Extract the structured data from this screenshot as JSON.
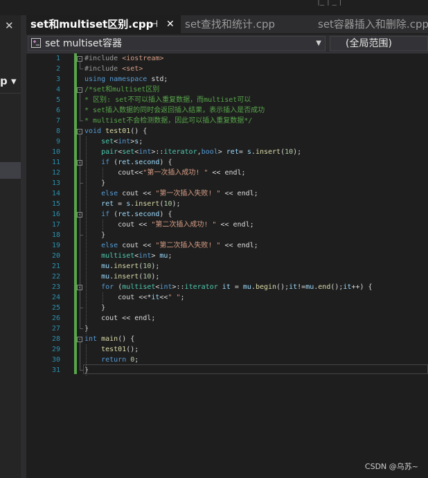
{
  "window": {
    "top_glyphs": "|_ | _ |"
  },
  "left_panel": {
    "close_glyph": "✕",
    "menu_label": "p ▾"
  },
  "tabs": [
    {
      "label": "set和multiset区别.cpp",
      "active": true,
      "pin_glyph": "⊣",
      "close_glyph": "✕"
    },
    {
      "label": "set查找和统计.cpp",
      "active": false
    },
    {
      "label": "set容器插入和删除.cpp",
      "active": false
    }
  ],
  "nav": {
    "scope_label": "set multiset容器",
    "member_label": "(全局范围)"
  },
  "editor": {
    "lines": [
      {
        "n": "1",
        "segs": [
          [
            "pp",
            "#include "
          ],
          [
            "st",
            "<iostream>"
          ]
        ]
      },
      {
        "n": "2",
        "segs": [
          [
            "pp",
            "#include "
          ],
          [
            "st",
            "<set>"
          ]
        ]
      },
      {
        "n": "3",
        "segs": [
          [
            "kw",
            "using namespace "
          ],
          [
            "",
            "std;"
          ]
        ]
      },
      {
        "n": "4",
        "segs": [
          [
            "cm",
            "/*set和multiset区别"
          ]
        ]
      },
      {
        "n": "5",
        "segs": [
          [
            "cm",
            "* 区别: set不可以插入重复数据，而multiset可以"
          ]
        ]
      },
      {
        "n": "6",
        "segs": [
          [
            "cm",
            "* set插入数据的同时会返回插入结果，表示插入是否成功"
          ]
        ]
      },
      {
        "n": "7",
        "segs": [
          [
            "cm",
            "* multiset不会检测数据，因此可以插入重复数据*/"
          ]
        ]
      },
      {
        "n": "8",
        "segs": [
          [
            "kw",
            "void "
          ],
          [
            "fn",
            "test01"
          ],
          [
            "",
            "() {"
          ]
        ]
      },
      {
        "n": "9",
        "segs": [
          [
            "",
            "    "
          ],
          [
            "ty",
            "set"
          ],
          [
            "",
            "<"
          ],
          [
            "kw",
            "int"
          ],
          [
            "",
            ">"
          ],
          [
            "va",
            "s"
          ],
          [
            "",
            ";"
          ]
        ]
      },
      {
        "n": "10",
        "segs": [
          [
            "",
            "    "
          ],
          [
            "ty",
            "pair"
          ],
          [
            "",
            "<"
          ],
          [
            "ty",
            "set"
          ],
          [
            "",
            "<"
          ],
          [
            "kw",
            "int"
          ],
          [
            "",
            ">::"
          ],
          [
            "ty",
            "iterator"
          ],
          [
            "",
            ","
          ],
          [
            "kw",
            "bool"
          ],
          [
            "",
            "> "
          ],
          [
            "va",
            "ret"
          ],
          [
            "",
            "= "
          ],
          [
            "va",
            "s"
          ],
          [
            "",
            "."
          ],
          [
            "fn",
            "insert"
          ],
          [
            "",
            "("
          ],
          [
            "nm",
            "10"
          ],
          [
            "",
            ");"
          ]
        ]
      },
      {
        "n": "11",
        "segs": [
          [
            "",
            "    "
          ],
          [
            "kw",
            "if "
          ],
          [
            "",
            "("
          ],
          [
            "va",
            "ret"
          ],
          [
            "",
            "."
          ],
          [
            "va",
            "second"
          ],
          [
            "",
            ") {"
          ]
        ]
      },
      {
        "n": "12",
        "segs": [
          [
            "",
            "        cout<<"
          ],
          [
            "st",
            "\"第一次插入成功! \""
          ],
          [
            "",
            " << endl;"
          ]
        ]
      },
      {
        "n": "13",
        "segs": [
          [
            "",
            "    }"
          ]
        ]
      },
      {
        "n": "14",
        "segs": [
          [
            "",
            "    "
          ],
          [
            "kw",
            "else "
          ],
          [
            "",
            "cout << "
          ],
          [
            "st",
            "\"第一次插入失败! \""
          ],
          [
            "",
            " << endl;"
          ]
        ]
      },
      {
        "n": "15",
        "segs": [
          [
            "",
            "    "
          ],
          [
            "va",
            "ret"
          ],
          [
            "",
            " = "
          ],
          [
            "va",
            "s"
          ],
          [
            "",
            "."
          ],
          [
            "fn",
            "insert"
          ],
          [
            "",
            "("
          ],
          [
            "nm",
            "10"
          ],
          [
            "",
            ");"
          ]
        ]
      },
      {
        "n": "16",
        "segs": [
          [
            "",
            "    "
          ],
          [
            "kw",
            "if "
          ],
          [
            "",
            "("
          ],
          [
            "va",
            "ret"
          ],
          [
            "",
            "."
          ],
          [
            "va",
            "second"
          ],
          [
            "",
            ") {"
          ]
        ]
      },
      {
        "n": "17",
        "segs": [
          [
            "",
            "        cout << "
          ],
          [
            "st",
            "\"第二次插入成功! \""
          ],
          [
            "",
            " << endl;"
          ]
        ]
      },
      {
        "n": "18",
        "segs": [
          [
            "",
            "    }"
          ]
        ]
      },
      {
        "n": "19",
        "segs": [
          [
            "",
            "    "
          ],
          [
            "kw",
            "else "
          ],
          [
            "",
            "cout << "
          ],
          [
            "st",
            "\"第二次插入失败! \""
          ],
          [
            "",
            " << endl;"
          ]
        ]
      },
      {
        "n": "20",
        "segs": [
          [
            "",
            "    "
          ],
          [
            "ty",
            "multiset"
          ],
          [
            "",
            "<"
          ],
          [
            "kw",
            "int"
          ],
          [
            "",
            "> "
          ],
          [
            "va",
            "mu"
          ],
          [
            "",
            ";"
          ]
        ]
      },
      {
        "n": "21",
        "segs": [
          [
            "",
            "    "
          ],
          [
            "va",
            "mu"
          ],
          [
            "",
            "."
          ],
          [
            "fn",
            "insert"
          ],
          [
            "",
            "("
          ],
          [
            "nm",
            "10"
          ],
          [
            "",
            ");"
          ]
        ]
      },
      {
        "n": "22",
        "segs": [
          [
            "",
            "    "
          ],
          [
            "va",
            "mu"
          ],
          [
            "",
            "."
          ],
          [
            "fn",
            "insert"
          ],
          [
            "",
            "("
          ],
          [
            "nm",
            "10"
          ],
          [
            "",
            ");"
          ]
        ]
      },
      {
        "n": "23",
        "segs": [
          [
            "",
            "    "
          ],
          [
            "kw",
            "for "
          ],
          [
            "",
            "("
          ],
          [
            "ty",
            "multiset"
          ],
          [
            "",
            "<"
          ],
          [
            "kw",
            "int"
          ],
          [
            "",
            ">::"
          ],
          [
            "ty",
            "iterator"
          ],
          [
            "",
            " "
          ],
          [
            "va",
            "it"
          ],
          [
            "",
            " = "
          ],
          [
            "va",
            "mu"
          ],
          [
            "",
            "."
          ],
          [
            "fn",
            "begin"
          ],
          [
            "",
            "();"
          ],
          [
            "va",
            "it"
          ],
          [
            "",
            "!="
          ],
          [
            "va",
            "mu"
          ],
          [
            "",
            "."
          ],
          [
            "fn",
            "end"
          ],
          [
            "",
            "();"
          ],
          [
            "va",
            "it"
          ],
          [
            "",
            "++) {"
          ]
        ]
      },
      {
        "n": "24",
        "segs": [
          [
            "",
            "        cout <<*"
          ],
          [
            "va",
            "it"
          ],
          [
            "",
            "<<"
          ],
          [
            "st",
            "\" \""
          ],
          [
            "",
            ";"
          ]
        ]
      },
      {
        "n": "25",
        "segs": [
          [
            "",
            "    }"
          ]
        ]
      },
      {
        "n": "26",
        "segs": [
          [
            "",
            "    cout << endl;"
          ]
        ]
      },
      {
        "n": "27",
        "segs": [
          [
            "",
            "}"
          ]
        ]
      },
      {
        "n": "28",
        "segs": [
          [
            "kw",
            "int "
          ],
          [
            "fn",
            "main"
          ],
          [
            "",
            "() {"
          ]
        ]
      },
      {
        "n": "29",
        "segs": [
          [
            "",
            "    "
          ],
          [
            "fn",
            "test01"
          ],
          [
            "",
            "();"
          ]
        ]
      },
      {
        "n": "30",
        "segs": [
          [
            "",
            "    "
          ],
          [
            "kw",
            "return "
          ],
          [
            "nm",
            "0"
          ],
          [
            "",
            ";"
          ]
        ]
      },
      {
        "n": "31",
        "segs": [
          [
            "",
            "}"
          ]
        ]
      }
    ]
  },
  "watermark": "CSDN @乌苏~"
}
